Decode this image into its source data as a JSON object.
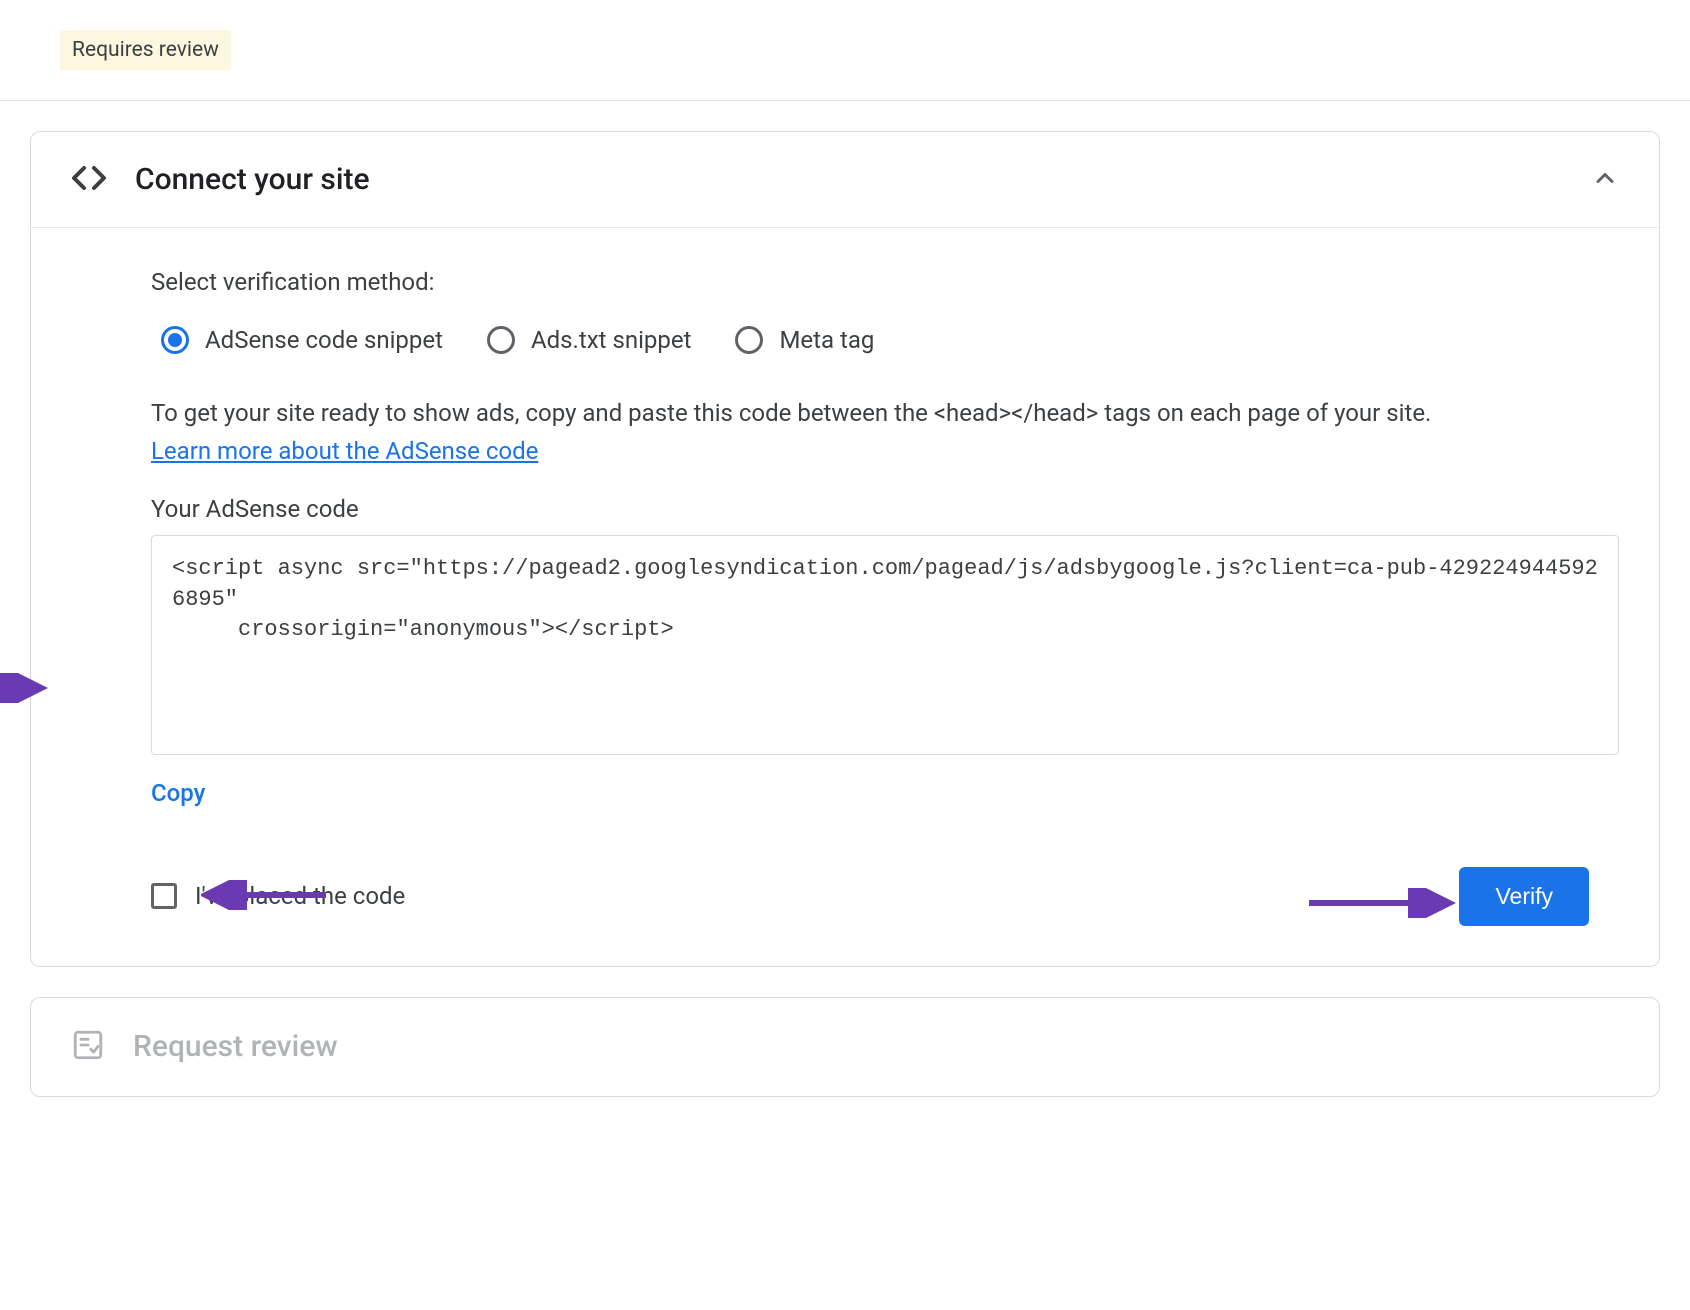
{
  "status_badge": "Requires review",
  "panel": {
    "title": "Connect your site",
    "select_label": "Select verification method:",
    "radios": {
      "option1": "AdSense code snippet",
      "option2": "Ads.txt snippet",
      "option3": "Meta tag"
    },
    "instructions_before_link": "To get your site ready to show ads, copy and paste this code between the <head></head> tags on each page of your site. ",
    "instructions_link": "Learn more about the AdSense code",
    "code_label": "Your AdSense code",
    "code_snippet": "<script async src=\"https://pagead2.googlesyndication.com/pagead/js/adsbygoogle.js?client=ca-pub-4292249445926895\"\n     crossorigin=\"anonymous\"></script>",
    "copy_label": "Copy",
    "checkbox_label": "I've placed the code",
    "verify_label": "Verify"
  },
  "panel2": {
    "title": "Request review"
  }
}
